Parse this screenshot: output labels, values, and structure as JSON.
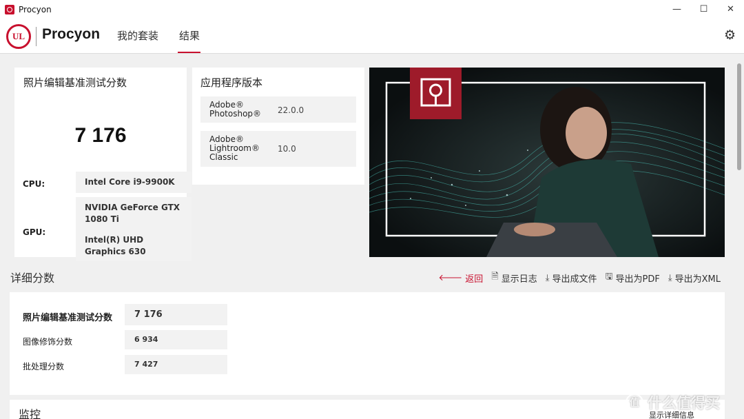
{
  "window": {
    "title": "Procyon",
    "controls": [
      "—",
      "☐",
      "✕"
    ]
  },
  "header": {
    "logo_text": "UL",
    "brand": "Procyon",
    "tabs": [
      {
        "label": "我的套装",
        "active": false
      },
      {
        "label": "结果",
        "active": true
      }
    ],
    "accent_color": "#c8102e"
  },
  "summary": {
    "heading": "照片编辑基准测试分数",
    "score": "7 176",
    "cpu_label": "CPU:",
    "cpu_value": "Intel Core i9-9900K",
    "gpu_label": "GPU:",
    "gpu_value_1": "NVIDIA GeForce GTX 1080 Ti",
    "gpu_value_2": "Intel(R) UHD Graphics 630"
  },
  "app_versions": {
    "heading": "应用程序版本",
    "apps": [
      {
        "name_lines": [
          "Adobe®",
          "Photoshop®"
        ],
        "version": "22.0.0"
      },
      {
        "name_lines": [
          "Adobe®",
          "Lightroom®",
          "Classic"
        ],
        "version": "10.0"
      }
    ]
  },
  "details": {
    "title": "详细分数",
    "actions": [
      {
        "label": "返回",
        "icon": "arrow-left-icon"
      },
      {
        "label": "显示日志",
        "icon": "document-icon"
      },
      {
        "label": "导出成文件",
        "icon": "download-icon"
      },
      {
        "label": "导出为PDF",
        "icon": "save-icon"
      },
      {
        "label": "导出为XML",
        "icon": "download-icon"
      }
    ],
    "rows": [
      {
        "label": "照片编辑基准测试分数",
        "value": "7 176"
      },
      {
        "label": "图像修饰分数",
        "value": "6 934"
      },
      {
        "label": "批处理分数",
        "value": "7 427"
      }
    ]
  },
  "monitor": {
    "title": "监控"
  },
  "footer": {
    "detail_toggle": "显示详细信息",
    "watermark": "什么值得买"
  }
}
